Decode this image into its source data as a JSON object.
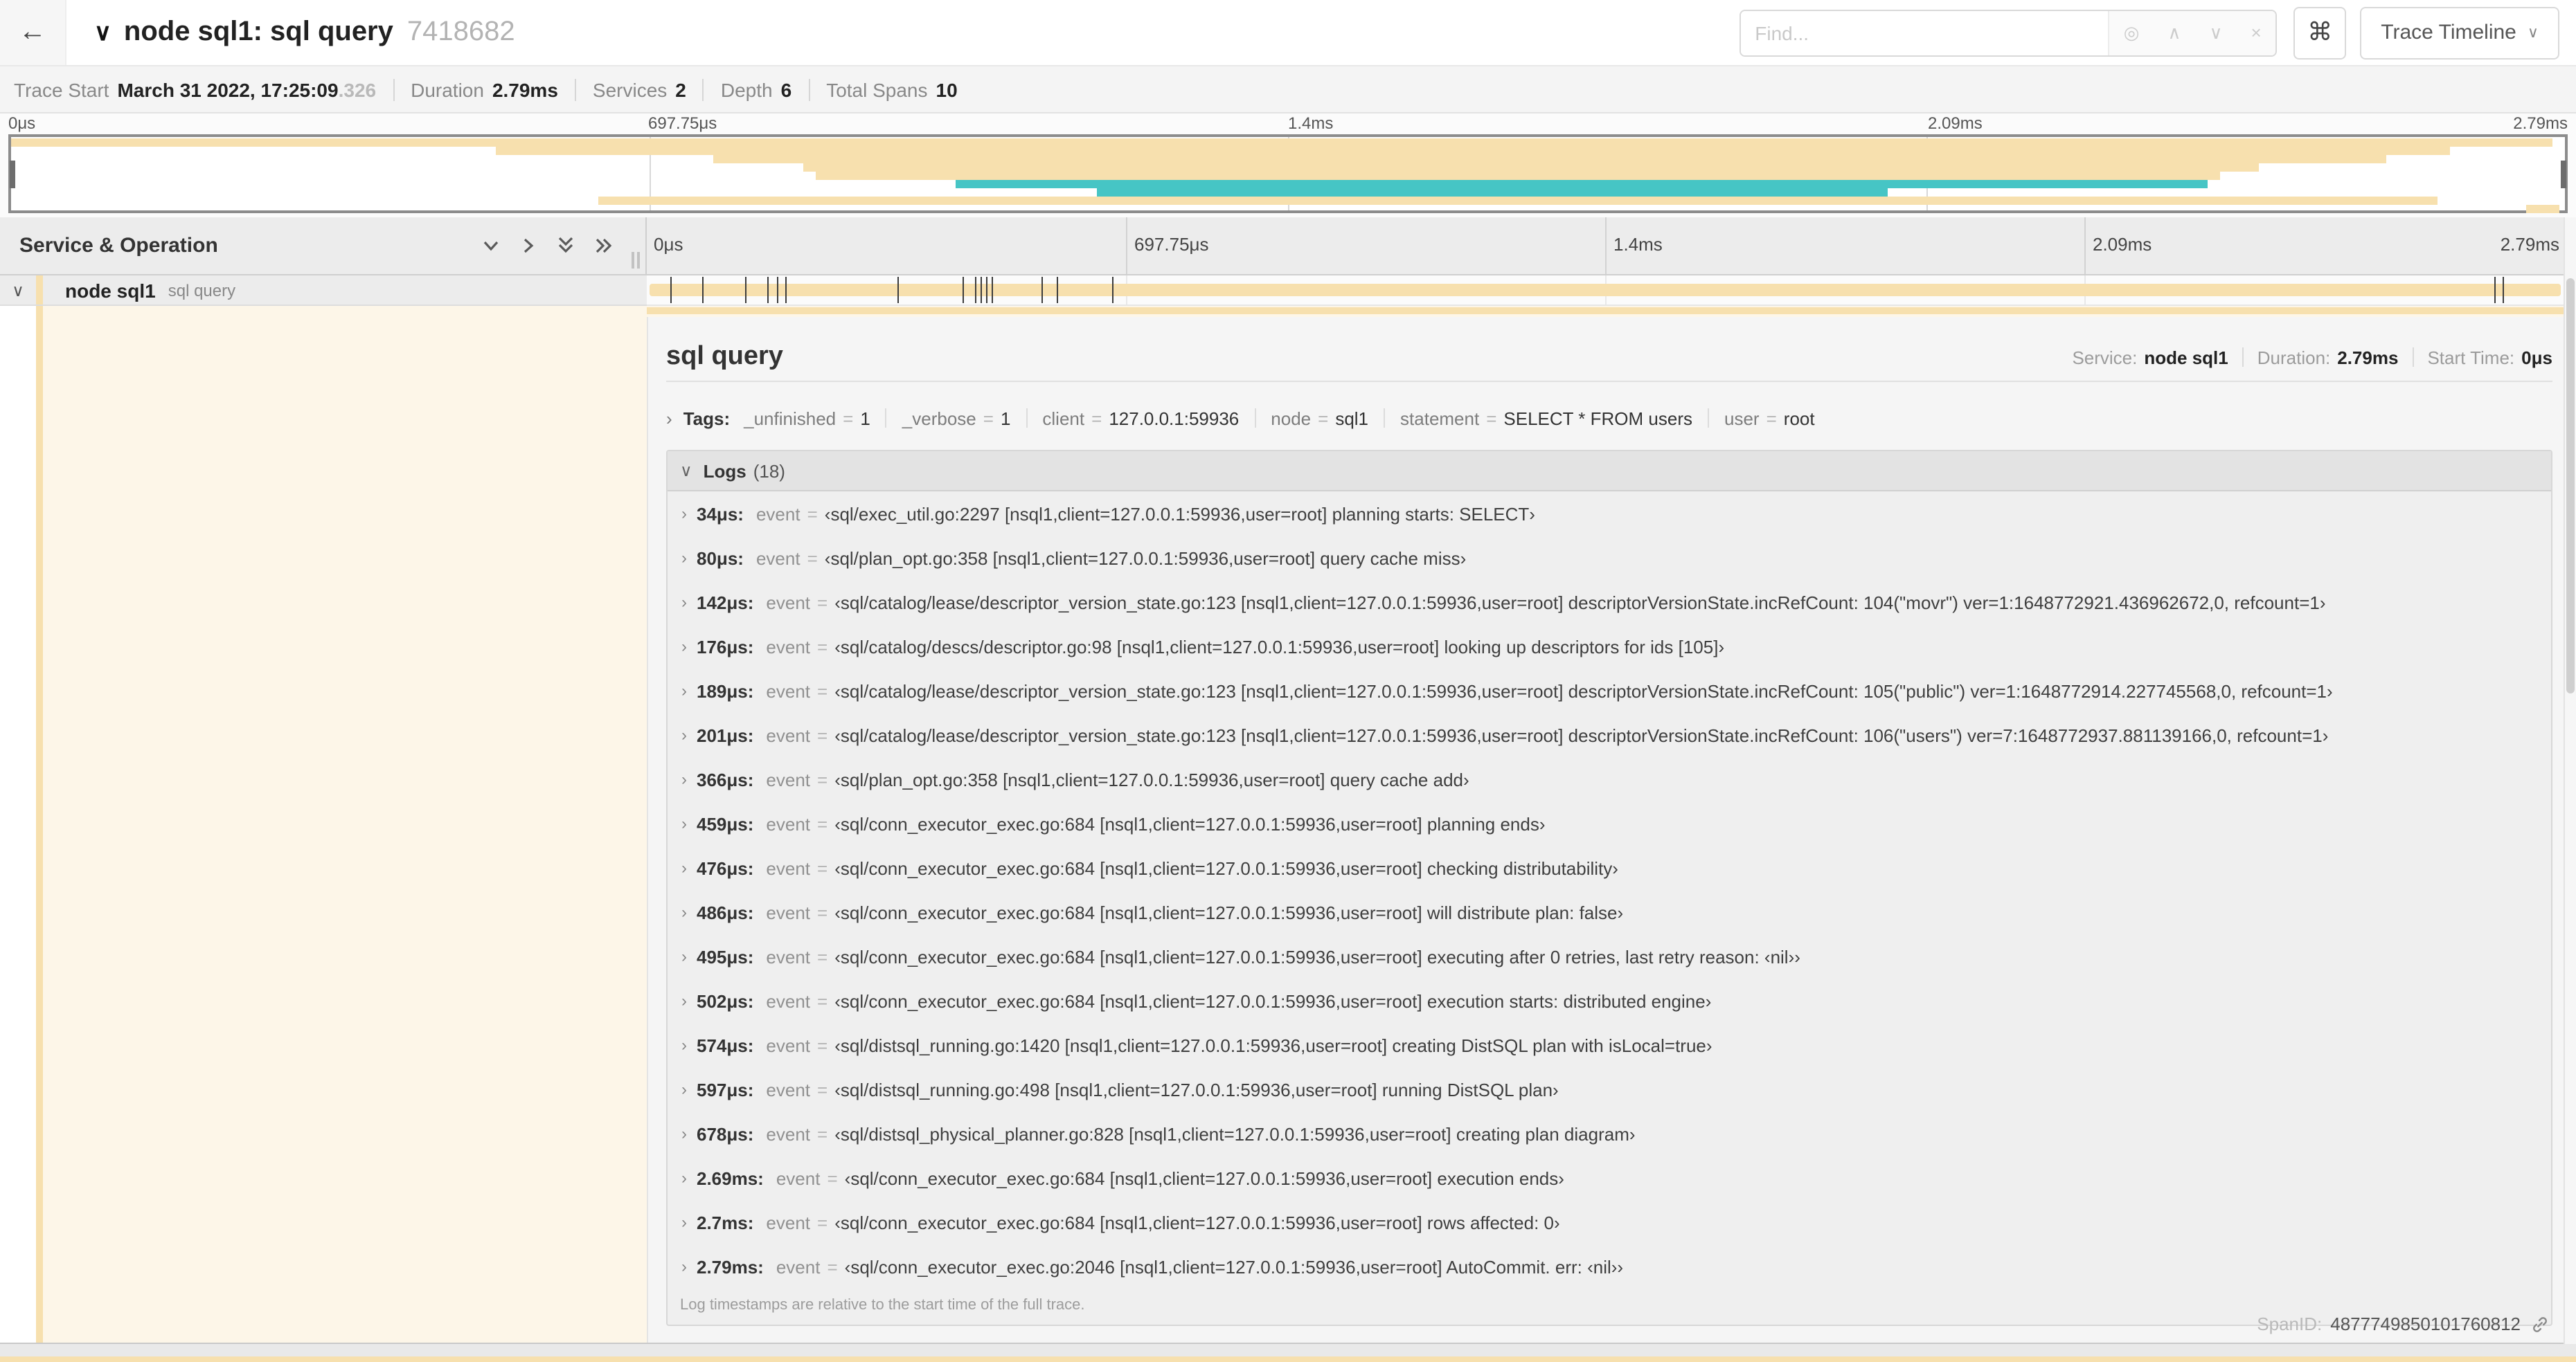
{
  "icons": {
    "back": "←",
    "collapse_caret": "∨",
    "chevron_right": "›",
    "crosshair": "◎",
    "caret_up": "∧",
    "caret_down": "∨",
    "close": "×",
    "command": "⌘"
  },
  "colors": {
    "span_tan": "#f7e0ae",
    "span_teal": "#46c5c5",
    "detail_cream": "#fdf6e8"
  },
  "header": {
    "title": "node sql1: sql query",
    "trace_id": "7418682",
    "find_placeholder": "Find...",
    "view_label": "Trace Timeline"
  },
  "summary": {
    "items": [
      {
        "label": "Trace Start",
        "value": "March 31 2022, 17:25:09",
        "suffix": ".326"
      },
      {
        "label": "Duration",
        "value": "2.79ms"
      },
      {
        "label": "Services",
        "value": "2"
      },
      {
        "label": "Depth",
        "value": "6"
      },
      {
        "label": "Total Spans",
        "value": "10"
      }
    ]
  },
  "minimap": {
    "ticks": [
      {
        "label": "0μs",
        "pct": 0
      },
      {
        "label": "697.75μs",
        "pct": 25
      },
      {
        "label": "1.4ms",
        "pct": 50
      },
      {
        "label": "2.09ms",
        "pct": 75
      },
      {
        "label": "2.79ms",
        "pct": 100
      }
    ],
    "grid_pcts": [
      25,
      50,
      75
    ],
    "rows": [
      {
        "color": "#f7e0ae",
        "start": 0,
        "end": 99.5
      },
      {
        "color": "#f7e0ae",
        "start": 19,
        "end": 95.5
      },
      {
        "color": "#f7e0ae",
        "start": 27.5,
        "end": 93
      },
      {
        "color": "#f7e0ae",
        "start": 31,
        "end": 88
      },
      {
        "color": "#f7e0ae",
        "start": 31.5,
        "end": 86.5
      },
      {
        "color": "#46c5c5",
        "start": 37,
        "end": 86
      },
      {
        "color": "#46c5c5",
        "start": 42.5,
        "end": 73.5
      },
      {
        "color": "#f7e0ae",
        "start": 23,
        "end": 95
      },
      {
        "color": "#f7e0ae",
        "start": 98.5,
        "end": 99.8
      }
    ]
  },
  "timeline": {
    "left_header": "Service & Operation",
    "ruler_ticks": [
      {
        "label": "0μs",
        "pct": 0
      },
      {
        "label": "697.75μs",
        "pct": 25
      },
      {
        "label": "1.4ms",
        "pct": 50
      },
      {
        "label": "2.09ms",
        "pct": 75
      },
      {
        "label": "2.79ms",
        "pct": 100
      }
    ],
    "grid_pcts": [
      25,
      50,
      75
    ],
    "span_row": {
      "service": "node sql1",
      "operation": "sql query",
      "bar_color": "#f7e0ae",
      "log_tick_pcts": [
        1.2,
        2.9,
        5.1,
        6.3,
        6.8,
        7.2,
        13.1,
        16.5,
        17.1,
        17.4,
        17.7,
        18.0,
        20.6,
        21.4,
        24.3,
        96.4,
        96.8
      ]
    }
  },
  "detail": {
    "title": "sql query",
    "meta": [
      {
        "label": "Service:",
        "value": "node sql1"
      },
      {
        "label": "Duration:",
        "value": "2.79ms"
      },
      {
        "label": "Start Time:",
        "value": "0μs"
      }
    ],
    "tags_label": "Tags:",
    "tags": [
      {
        "key": "_unfinished",
        "value": "1"
      },
      {
        "key": "_verbose",
        "value": "1"
      },
      {
        "key": "client",
        "value": "127.0.0.1:59936"
      },
      {
        "key": "node",
        "value": "sql1"
      },
      {
        "key": "statement",
        "value": "SELECT * FROM users"
      },
      {
        "key": "user",
        "value": "root"
      }
    ],
    "logs": {
      "title": "Logs",
      "count": "(18)",
      "field_label": "event",
      "eq": "=",
      "entries": [
        {
          "time": "34μs:",
          "value": "‹sql/exec_util.go:2297 [nsql1,client=127.0.0.1:59936,user=root] planning starts: SELECT›"
        },
        {
          "time": "80μs:",
          "value": "‹sql/plan_opt.go:358 [nsql1,client=127.0.0.1:59936,user=root] query cache miss›"
        },
        {
          "time": "142μs:",
          "value": "‹sql/catalog/lease/descriptor_version_state.go:123 [nsql1,client=127.0.0.1:59936,user=root] descriptorVersionState.incRefCount: 104(\"movr\") ver=1:1648772921.436962672,0, refcount=1›"
        },
        {
          "time": "176μs:",
          "value": "‹sql/catalog/descs/descriptor.go:98 [nsql1,client=127.0.0.1:59936,user=root] looking up descriptors for ids [105]›"
        },
        {
          "time": "189μs:",
          "value": "‹sql/catalog/lease/descriptor_version_state.go:123 [nsql1,client=127.0.0.1:59936,user=root] descriptorVersionState.incRefCount: 105(\"public\") ver=1:1648772914.227745568,0, refcount=1›"
        },
        {
          "time": "201μs:",
          "value": "‹sql/catalog/lease/descriptor_version_state.go:123 [nsql1,client=127.0.0.1:59936,user=root] descriptorVersionState.incRefCount: 106(\"users\") ver=7:1648772937.881139166,0, refcount=1›"
        },
        {
          "time": "366μs:",
          "value": "‹sql/plan_opt.go:358 [nsql1,client=127.0.0.1:59936,user=root] query cache add›"
        },
        {
          "time": "459μs:",
          "value": "‹sql/conn_executor_exec.go:684 [nsql1,client=127.0.0.1:59936,user=root] planning ends›"
        },
        {
          "time": "476μs:",
          "value": "‹sql/conn_executor_exec.go:684 [nsql1,client=127.0.0.1:59936,user=root] checking distributability›"
        },
        {
          "time": "486μs:",
          "value": "‹sql/conn_executor_exec.go:684 [nsql1,client=127.0.0.1:59936,user=root] will distribute plan: false›"
        },
        {
          "time": "495μs:",
          "value": "‹sql/conn_executor_exec.go:684 [nsql1,client=127.0.0.1:59936,user=root] executing after 0 retries, last retry reason: ‹nil››"
        },
        {
          "time": "502μs:",
          "value": "‹sql/conn_executor_exec.go:684 [nsql1,client=127.0.0.1:59936,user=root] execution starts: distributed engine›"
        },
        {
          "time": "574μs:",
          "value": "‹sql/distsql_running.go:1420 [nsql1,client=127.0.0.1:59936,user=root] creating DistSQL plan with isLocal=true›"
        },
        {
          "time": "597μs:",
          "value": "‹sql/distsql_running.go:498 [nsql1,client=127.0.0.1:59936,user=root] running DistSQL plan›"
        },
        {
          "time": "678μs:",
          "value": "‹sql/distsql_physical_planner.go:828 [nsql1,client=127.0.0.1:59936,user=root] creating plan diagram›"
        },
        {
          "time": "2.69ms:",
          "value": "‹sql/conn_executor_exec.go:684 [nsql1,client=127.0.0.1:59936,user=root] execution ends›"
        },
        {
          "time": "2.7ms:",
          "value": "‹sql/conn_executor_exec.go:684 [nsql1,client=127.0.0.1:59936,user=root] rows affected: 0›"
        },
        {
          "time": "2.79ms:",
          "value": "‹sql/conn_executor_exec.go:2046 [nsql1,client=127.0.0.1:59936,user=root] AutoCommit. err: ‹nil››"
        }
      ],
      "footnote": "Log timestamps are relative to the start time of the full trace."
    },
    "span_id_label": "SpanID:",
    "span_id": "4877749850101760812"
  }
}
